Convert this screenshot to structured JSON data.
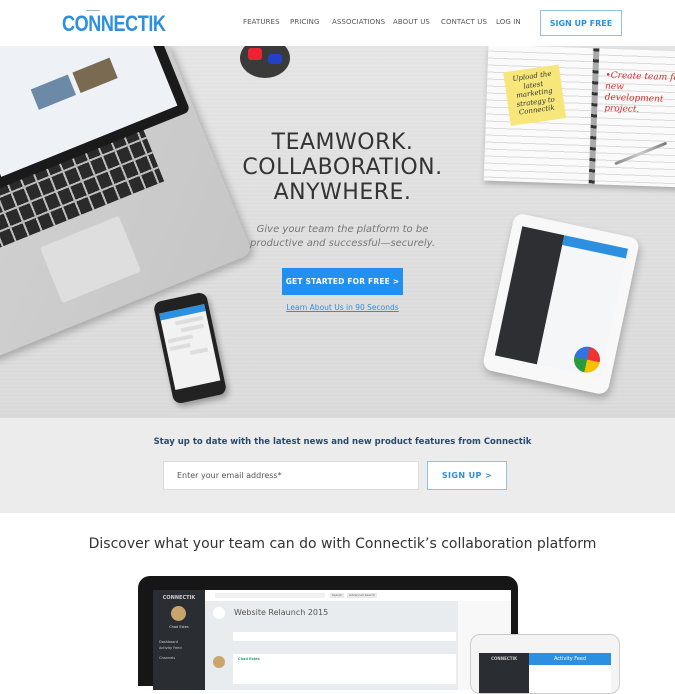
{
  "header": {
    "logo": "CONNECTIK",
    "nav": [
      "FEATURES",
      "PRICING",
      "ASSOCIATIONS",
      "ABOUT US",
      "CONTACT US",
      "LOG IN"
    ],
    "signup_label": "SIGN UP FREE"
  },
  "hero": {
    "title_lines": [
      "TEAMWORK.",
      "COLLABORATION.",
      "ANYWHERE."
    ],
    "subtitle_lines": [
      "Give your team the platform to be",
      "productive and successful—securely."
    ],
    "cta_label": "GET STARTED FOR FREE  >",
    "video_link": "Learn About Us in 90 Seconds",
    "sticky_note": "Upload the latest marketing strategy to Connectik",
    "notebook_note": "•Create team for new development project."
  },
  "newsletter": {
    "title": "Stay up to date with the latest news and new product features from Connectik",
    "email_placeholder": "Enter your email address*",
    "signup_label": "SIGN UP  >"
  },
  "discover": {
    "title": "Discover what your team can do with Connectik’s collaboration platform"
  },
  "mockup": {
    "app_logo": "CONNECTIK",
    "user_name": "Chad Estes",
    "nav": [
      "Dashboard",
      "Activity Feed",
      "Channels"
    ],
    "search_btn": "Search",
    "adv_search_btn": "Advanced Search",
    "channel_title": "Website Relaunch 2015",
    "post_author": "Chad Estes",
    "tablet_title": "Activity Feed"
  },
  "colors": {
    "brand_blue": "#2d8fe0",
    "cta_blue": "#2290f0",
    "newsletter_title": "#2a4b6e"
  }
}
